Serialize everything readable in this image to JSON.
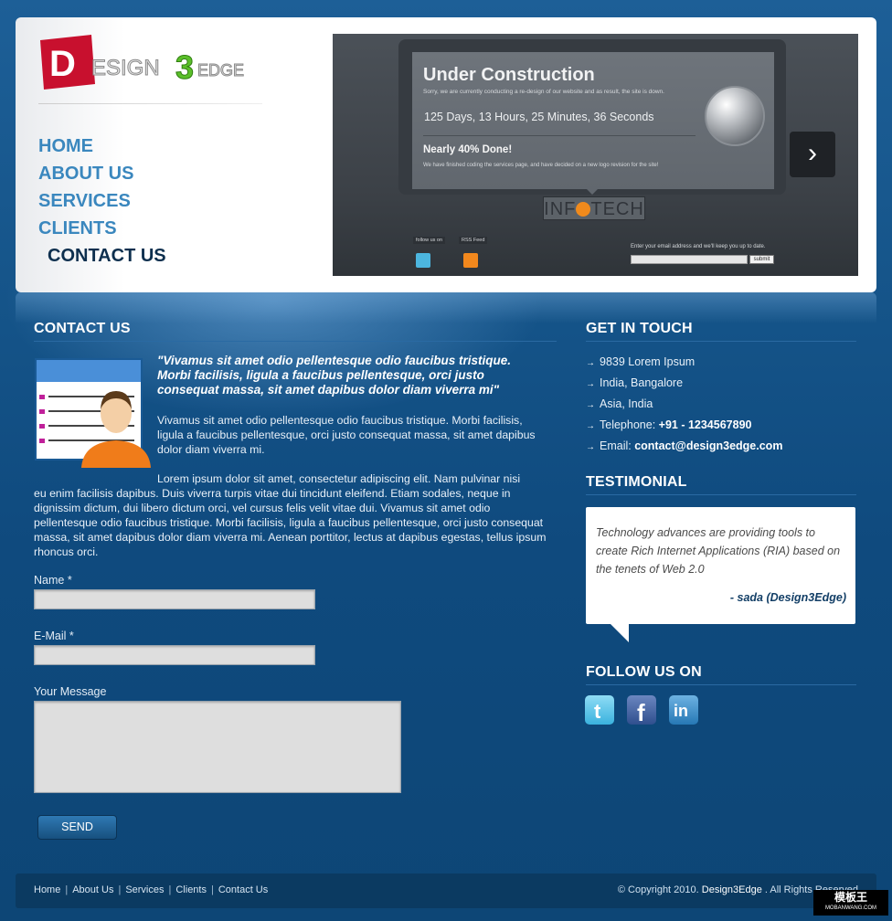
{
  "header": {
    "logo_text": "DESIGN3EDGE",
    "nav": [
      {
        "label": "HOME"
      },
      {
        "label": "ABOUT US"
      },
      {
        "label": "SERVICES"
      },
      {
        "label": "CLIENTS"
      },
      {
        "label": "CONTACT US",
        "active": true
      }
    ]
  },
  "slider": {
    "title": "Under Construction",
    "subtitle": "Sorry, we are currently conducting a re-design of our website and as result, the site is down.",
    "countdown": "125 Days, 13 Hours, 25 Minutes, 36 Seconds",
    "progress_label": "Nearly 40% Done!",
    "progress_value": 0.4,
    "note": "We have finished coding the services page, and have decided on a new logo revision for the site!",
    "brand_left": "INF",
    "brand_right": "TECH",
    "follow_label": "follow us on",
    "rss_label": "RSS Feed",
    "email_prompt": "Enter your email address and we'll keep you up to date.",
    "submit_label": "submit",
    "next_icon": "chevron-right-icon"
  },
  "main": {
    "heading": "CONTACT US",
    "quote": "\"Vivamus sit amet odio pellentesque odio faucibus tristique. Morbi facilisis, ligula a faucibus pellentesque, orci justo consequat massa, sit amet dapibus dolor diam viverra mi\"",
    "para1": "Vivamus sit amet odio pellentesque odio faucibus tristique. Morbi facilisis, ligula a faucibus pellentesque, orci justo consequat massa, sit amet dapibus dolor diam viverra mi.",
    "para2_line1": "Lorem ipsum dolor sit amet, consectetur adipiscing elit. Nam pulvinar nisi",
    "para2_rest": "eu enim facilisis dapibus. Duis viverra turpis vitae dui tincidunt eleifend. Etiam sodales, neque in dignissim dictum, dui libero dictum orci, vel cursus felis velit vitae dui. Vivamus sit amet odio pellentesque odio faucibus tristique. Morbi facilisis, ligula a faucibus pellentesque, orci justo consequat massa, sit amet dapibus dolor diam viverra mi. Aenean porttitor, lectus at dapibus egestas, tellus ipsum rhoncus orci.",
    "form": {
      "name_label": "Name *",
      "name_value": "",
      "email_label": "E-Mail *",
      "email_value": "",
      "message_label": "Your Message",
      "message_value": "",
      "send_label": "SEND"
    }
  },
  "sidebar": {
    "touch_heading": "GET IN TOUCH",
    "address": [
      {
        "text": "9839 Lorem Ipsum",
        "strong": ""
      },
      {
        "text": "India, Bangalore",
        "strong": ""
      },
      {
        "text": "Asia, India",
        "strong": ""
      },
      {
        "text": "Telephone: ",
        "strong": "+91 - 1234567890"
      },
      {
        "text": "Email: ",
        "strong": "contact@design3edge.com"
      }
    ],
    "testimonial_heading": "TESTIMONIAL",
    "testimonial_text": "Technology advances are providing tools to create Rich Internet Applications (RIA) based on the tenets of Web 2.0",
    "testimonial_author": "- sada (Design3Edge)",
    "follow_heading": "FOLLOW US ON",
    "social": [
      {
        "name": "twitter-icon",
        "glyph": "t",
        "color": "#58c3e8"
      },
      {
        "name": "facebook-icon",
        "glyph": "f",
        "color": "#3b5a9a"
      },
      {
        "name": "linkedin-icon",
        "glyph": "in",
        "color": "#2f86c2"
      }
    ]
  },
  "footer": {
    "links": [
      "Home",
      "About Us",
      "Services",
      "Clients",
      "Contact Us"
    ],
    "copyright_prefix": "© Copyright 2010.",
    "copyright_brand": "Design3Edge",
    "copyright_suffix": ". All Rights Reserved"
  },
  "watermark": {
    "main": "模板王",
    "sub": "MOBANWANG.COM"
  }
}
